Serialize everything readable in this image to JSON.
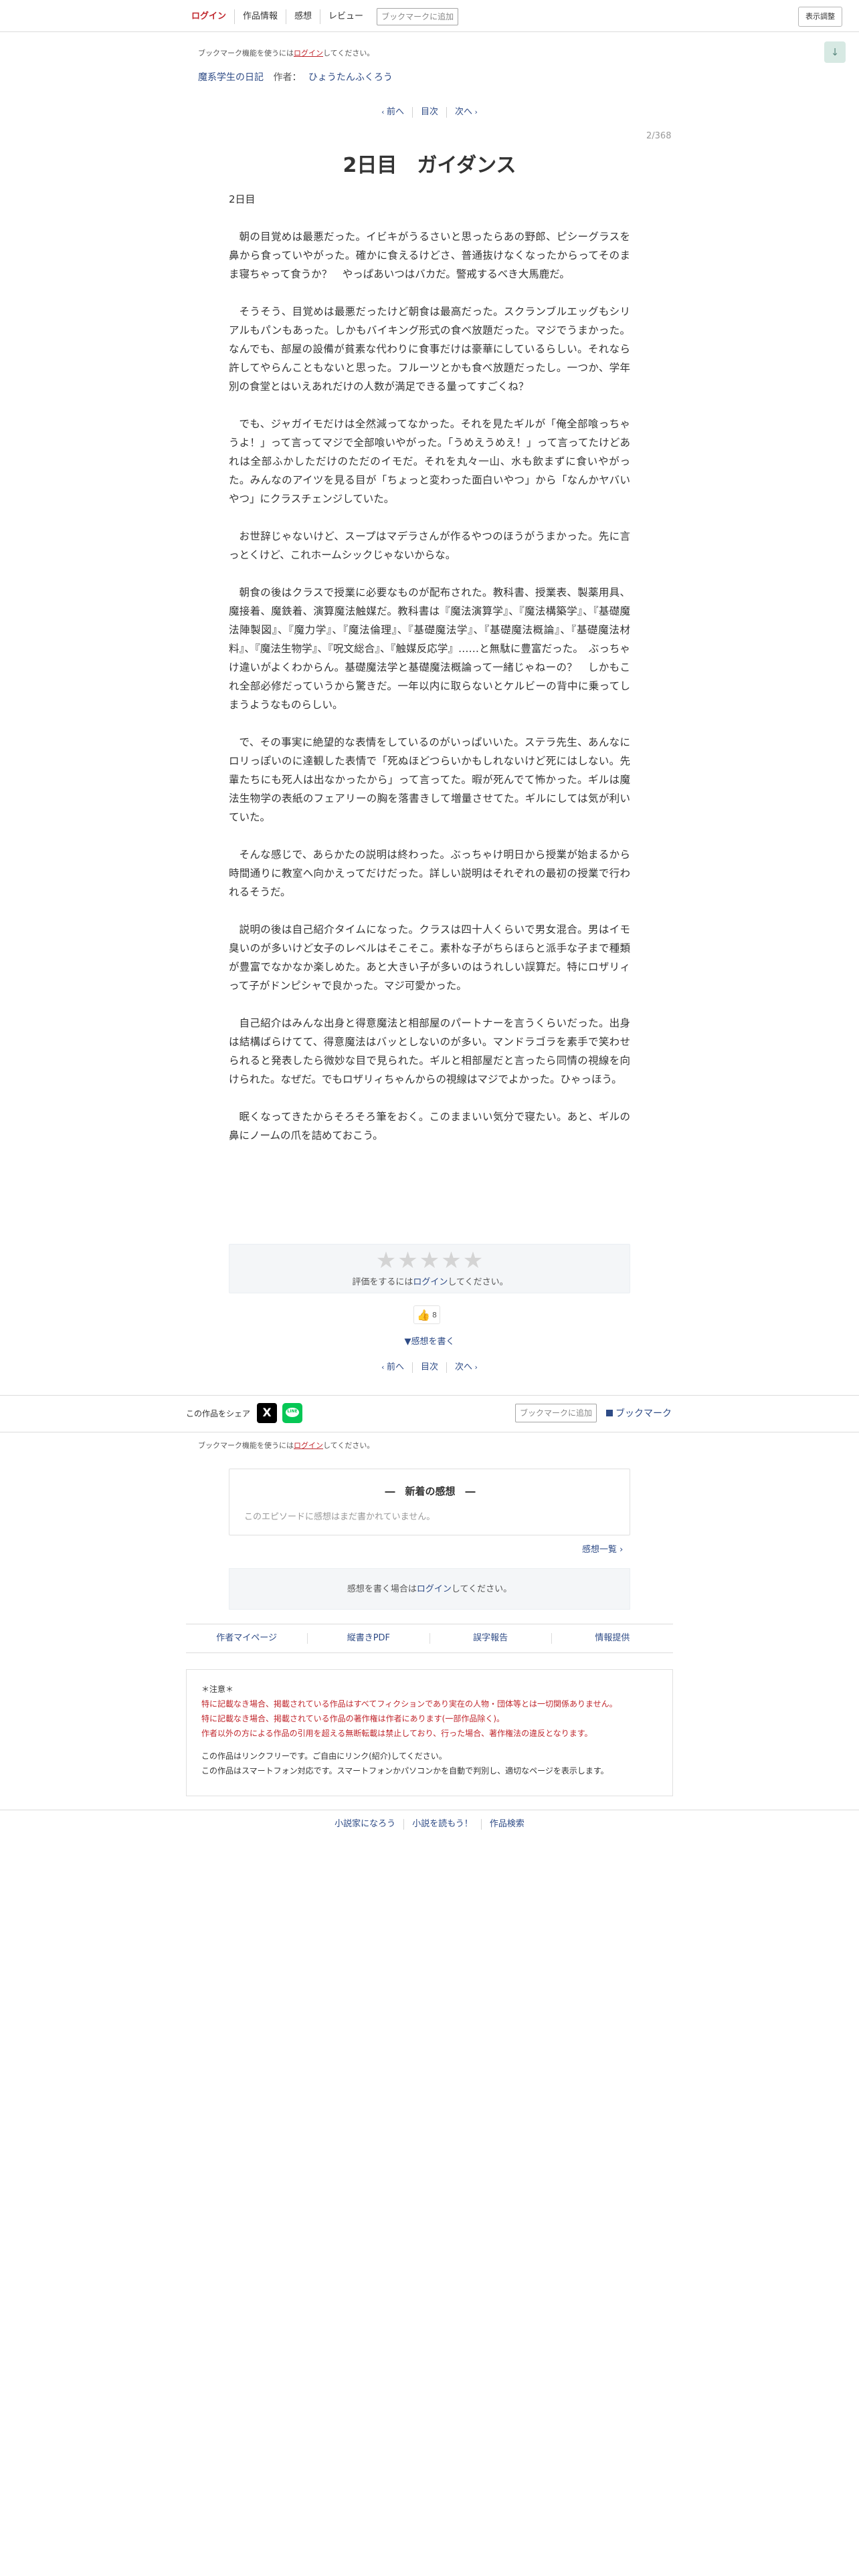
{
  "header": {
    "login": "ログイン",
    "nav": [
      "作品情報",
      "感想",
      "レビュー"
    ],
    "bookmark_add": "ブックマークに追加",
    "display_settings": "表示調整"
  },
  "bookmark_notice": {
    "before": "ブックマーク機能を使うには",
    "link": "ログイン",
    "after": "してください。"
  },
  "scroll_button": "↓",
  "breadcrumb": {
    "series": "魔系学生の日記",
    "author_label": "作者：",
    "author": "ひょうたんふくろう"
  },
  "pager": {
    "prev": "前へ",
    "toc": "目次",
    "next": "次へ"
  },
  "episode": {
    "counter": "2/368",
    "title": "2日目　ガイダンス",
    "subtitle": "2日目",
    "paragraphs": [
      "朝の目覚めは最悪だった。イビキがうるさいと思ったらあの野郎、ピシーグラスを鼻から食っていやがった。確かに食えるけどさ、普通抜けなくなったからってそのまま寝ちゃって食うか？　やっぱあいつはバカだ。警戒するべき大馬鹿だ。",
      "そうそう、目覚めは最悪だったけど朝食は最高だった。スクランブルエッグもシリアルもパンもあった。しかもバイキング形式の食べ放題だった。マジでうまかった。なんでも、部屋の設備が貧素な代わりに食事だけは豪華にしているらしい。それなら許してやらんこともないと思った。フルーツとかも食べ放題だったし。一つか、学年別の食堂とはいえあれだけの人数が満足できる量ってすごくね？",
      "でも、ジャガイモだけは全然減ってなかった。それを見たギルが「俺全部喰っちゃうよ！」って言ってマジで全部喰いやがった。「うめえうめえ！」って言ってたけどあれは全部ふかしただけのただのイモだ。それを丸々一山、水も飲まずに食いやがった。みんなのアイツを見る目が「ちょっと変わった面白いやつ」から「なんかヤバいやつ」にクラスチェンジしていた。",
      "お世辞じゃないけど、スープはマデラさんが作るやつのほうがうまかった。先に言っとくけど、これホームシックじゃないからな。",
      "朝食の後はクラスで授業に必要なものが配布された。教科書、授業表、製薬用具、魔接着、魔鉄着、演算魔法触媒だ。教科書は『魔法演算学』、『魔法構築学』、『基礎魔法陣製図』、『魔力学』、『魔法倫理』、『基礎魔法学』、『基礎魔法概論』、『基礎魔法材料』、『魔法生物学』、『呪文総合』、『触媒反応学』……と無駄に豊富だった。　ぶっちゃけ違いがよくわからん。基礎魔法学と基礎魔法概論って一緒じゃねーの？　しかもこれ全部必修だっていうから驚きだ。一年以内に取らないとケルビーの背中に乗ってしまうようなものらしい。",
      "で、その事実に絶望的な表情をしているのがいっぱいいた。ステラ先生、あんなにロリっぽいのに達観した表情で「死ぬほどつらいかもしれないけど死にはしない。先輩たちにも死人は出なかったから」って言ってた。暇が死んでて怖かった。ギルは魔法生物学の表紙のフェアリーの胸を落書きして増量させてた。ギルにしては気が利いていた。",
      "そんな感じで、あらかたの説明は終わった。ぶっちゃけ明日から授業が始まるから時間通りに教室へ向かえってだけだった。詳しい説明はそれぞれの最初の授業で行われるそうだ。",
      "説明の後は自己紹介タイムになった。クラスは四十人くらいで男女混合。男はイモ臭いのが多いけど女子のレベルはそこそこ。素朴な子がちらほらと派手な子まで種類が豊富でなかなか楽しめた。あと大きい子が多いのはうれしい誤算だ。特にロザリィって子がドンピシャで良かった。マジ可愛かった。",
      "自己紹介はみんな出身と得意魔法と相部屋のパートナーを言うくらいだった。出身は結構ばらけてて、得意魔法はバッとしないのが多い。マンドラゴラを素手で笑わせられると発表したら微妙な目で見られた。ギルと相部屋だと言ったら同情の視線を向けられた。なぜだ。でもロザリィちゃんからの視線はマジでよかった。ひゃっほう。",
      "眠くなってきたからそろそろ筆をおく。このままいい気分で寝たい。あと、ギルの鼻にノームの爪を詰めておこう。"
    ]
  },
  "rating": {
    "stars": "★★★★★",
    "before": "評価をするには",
    "link": "ログイン",
    "after": "してください。"
  },
  "like": {
    "icon": "thumbs-up-icon",
    "count": "8"
  },
  "write_impression": "感想を書く",
  "share": {
    "label": "この作品をシェア",
    "x": "X",
    "line": "LINE"
  },
  "bookmark_bottom": {
    "add": "ブックマークに追加",
    "link": "ブックマーク"
  },
  "impressions": {
    "title": "―　新着の感想　―",
    "empty": "このエピソードに感想はまだ書かれていません。",
    "list_link": "感想一覧"
  },
  "impression_login": {
    "before": "感想を書く場合は",
    "link": "ログイン",
    "after": "してください。"
  },
  "footer_links": [
    "作者マイページ",
    "縦書きPDF",
    "誤字報告",
    "情報提供"
  ],
  "notice": {
    "heading": "＊注意＊",
    "red_lines": [
      "特に記載なき場合、掲載されている作品はすべてフィクションであり実在の人物・団体等とは一切関係ありません。",
      "特に記載なき場合、掲載されている作品の著作権は作者にあります(一部作品除く)。",
      "作者以外の方による作品の引用を超える無断転載は禁止しており、行った場合、著作権法の違反となります。"
    ],
    "lines": [
      "この作品はリンクフリーです。ご自由にリンク(紹介)してください。",
      "この作品はスマートフォン対応です。スマートフォンかパソコンかを自動で判別し、適切なページを表示します。"
    ]
  },
  "site_links": [
    "小説家になろう",
    "小説を読もう！",
    "作品検索"
  ],
  "colors": {
    "accent_red": "#c0272d",
    "link_blue": "#2e4b86",
    "box_bg": "#f4f6f8"
  }
}
